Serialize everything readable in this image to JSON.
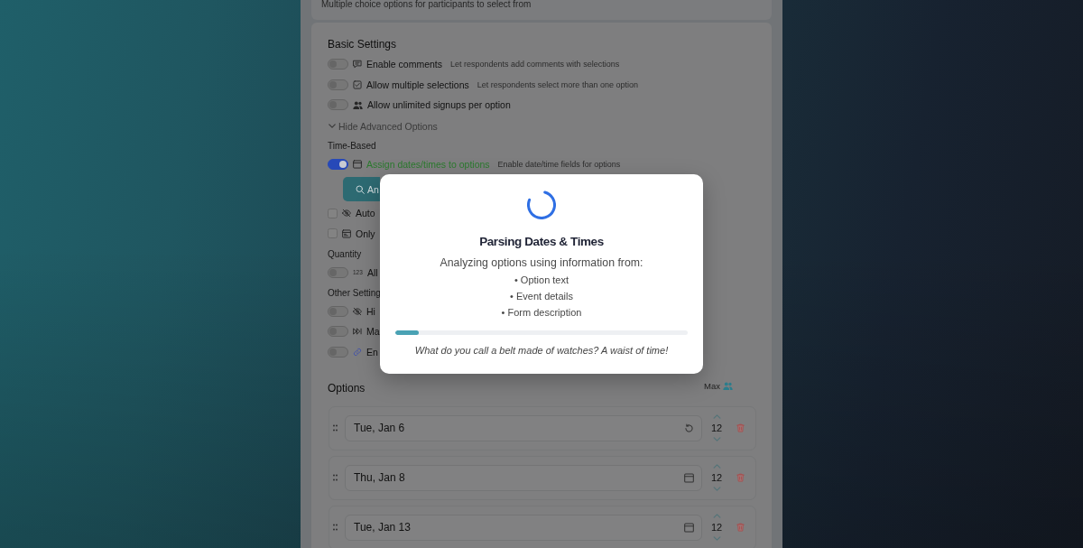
{
  "form_header": {
    "description": "Multiple choice options for participants to select from"
  },
  "basic_settings": {
    "title": "Basic Settings",
    "toggles": [
      {
        "label": "Enable comments",
        "hint": "Let respondents add comments with selections",
        "on": false
      },
      {
        "label": "Allow multiple selections",
        "hint": "Let respondents select more than one option",
        "on": false
      },
      {
        "label": "Allow unlimited signups per option",
        "on": false
      }
    ]
  },
  "advanced_link": {
    "label": "Hide Advanced Options",
    "expanded": true
  },
  "advanced_groups": [
    {
      "title": "Time-Based",
      "items": [
        {
          "kind": "toggle",
          "label": "Assign dates/times to options",
          "hint": "Enable date/time fields for options",
          "on": true
        },
        {
          "kind": "button",
          "label": "An"
        },
        {
          "kind": "checkbox",
          "label": "Auto",
          "checked": false
        },
        {
          "kind": "checkbox",
          "label": "Only",
          "checked": false
        }
      ]
    },
    {
      "title": "Quantity",
      "items": [
        {
          "kind": "toggle",
          "symbol": "123",
          "label": "All",
          "on": false
        }
      ]
    },
    {
      "title": "Other Setting",
      "items": [
        {
          "kind": "toggle",
          "label": "Hi",
          "on": false
        },
        {
          "kind": "toggle",
          "label": "Ma",
          "on": false
        },
        {
          "kind": "toggle",
          "label": "En",
          "on": false
        }
      ]
    }
  ],
  "options": {
    "title": "Options",
    "max_label": "Max",
    "rows": [
      {
        "value": "Tue, Jan 6",
        "parsing": true,
        "max": "12"
      },
      {
        "value": "Thu, Jan 8",
        "parsing": false,
        "max": "12"
      },
      {
        "value": "Tue, Jan 13",
        "parsing": false,
        "max": "12"
      }
    ]
  },
  "modal": {
    "title": "Parsing Dates & Times",
    "subtitle": "Analyzing options using information from:",
    "sources": [
      "• Option text",
      "• Event details",
      "• Form description"
    ],
    "progress": {
      "level": 0.08
    },
    "joke": "What do you call a belt made of watches? A waist of time!"
  }
}
